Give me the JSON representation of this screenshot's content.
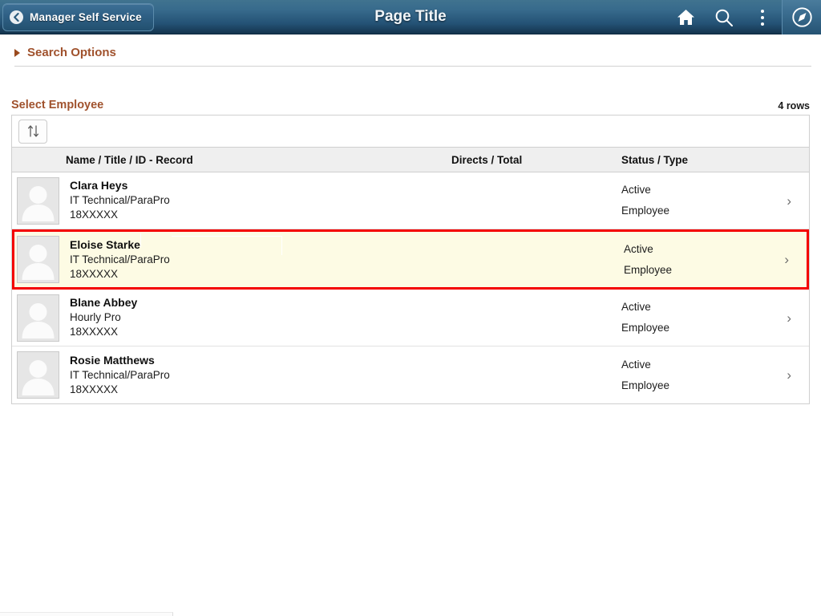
{
  "header": {
    "back_label": "Manager Self Service",
    "back_icon": "chevron-left-icon",
    "title": "Page Title",
    "icons": [
      {
        "name": "home-icon",
        "label": "Home"
      },
      {
        "name": "search-icon",
        "label": "Search"
      },
      {
        "name": "actions-menu-icon",
        "label": "Actions"
      },
      {
        "name": "navbar-compass-icon",
        "label": "NavBar"
      }
    ],
    "gradient_top": "#40738f",
    "gradient_bottom": "#14344d"
  },
  "search_options": {
    "label": "Search Options",
    "expanded": false,
    "accent_color": "#a0522d"
  },
  "grid": {
    "title": "Select Employee",
    "rows_count_label": "4 rows",
    "sort_button_label": "Sort",
    "columns": [
      {
        "key": "name",
        "label": "Name / Title / ID - Record"
      },
      {
        "key": "direct",
        "label": "Directs / Total"
      },
      {
        "key": "status",
        "label": "Status / Type"
      }
    ],
    "selected_index": 1,
    "selection_border_color": "#f40000",
    "selection_background": "#fdfbe4",
    "rows": [
      {
        "name": "Clara Heys",
        "title": "IT Technical/ParaPro",
        "id": "18XXXXX",
        "directs": "",
        "status": "Active",
        "type": "Employee",
        "chevron": "›"
      },
      {
        "name": "Eloise Starke",
        "title": "IT Technical/ParaPro",
        "id": "18XXXXX",
        "directs": "",
        "status": "Active",
        "type": "Employee",
        "chevron": "›"
      },
      {
        "name": "Blane Abbey",
        "title": "Hourly Pro",
        "id": "18XXXXX",
        "directs": "",
        "status": "Active",
        "type": "Employee",
        "chevron": "›"
      },
      {
        "name": "Rosie Matthews",
        "title": "IT Technical/ParaPro",
        "id": "18XXXXX",
        "directs": "",
        "status": "Active",
        "type": "Employee",
        "chevron": "›"
      }
    ]
  }
}
